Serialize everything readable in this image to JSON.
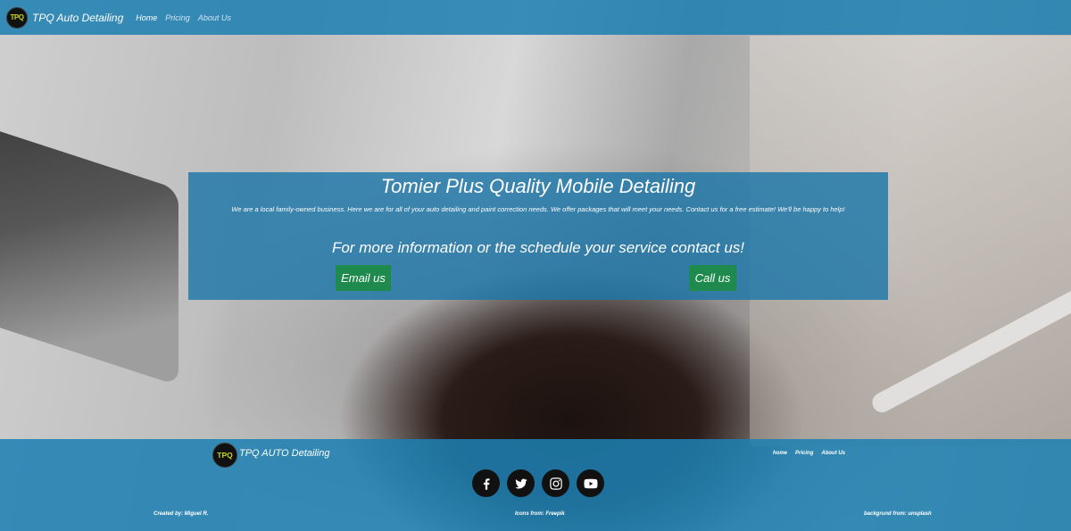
{
  "navbar": {
    "logo_text": "TPQ",
    "brand": "TPQ Auto Detailing",
    "links": [
      {
        "label": "Home",
        "active": true
      },
      {
        "label": "Pricing",
        "active": false
      },
      {
        "label": "About Us",
        "active": false
      }
    ],
    "background": "#1c80b2"
  },
  "hero": {
    "title": "Tomier Plus Quality Mobile Detailing",
    "description": "We are a local family-owned business. Here we are for all of your auto detailing and paint correction needs. We offer packages that will meet your needs. Contact us for a free estimate! We'll be happy to help!",
    "contact_text": "For more information or the schedule your service contact us!",
    "email_button": "Email us",
    "call_button": "Call us",
    "button_color": "#1f8a4e"
  },
  "footer": {
    "logo_text": "TPQ",
    "brand": "TPQ AUTO Detailing",
    "links": [
      "home",
      "Pricing",
      "About Us"
    ],
    "socials": [
      "facebook-icon",
      "twitter-icon",
      "instagram-icon",
      "youtube-icon"
    ],
    "credits": {
      "created": "Created by: Miguel R.",
      "icons": "Icons from: Freepik",
      "background": "backgrund from: unsplash"
    }
  }
}
